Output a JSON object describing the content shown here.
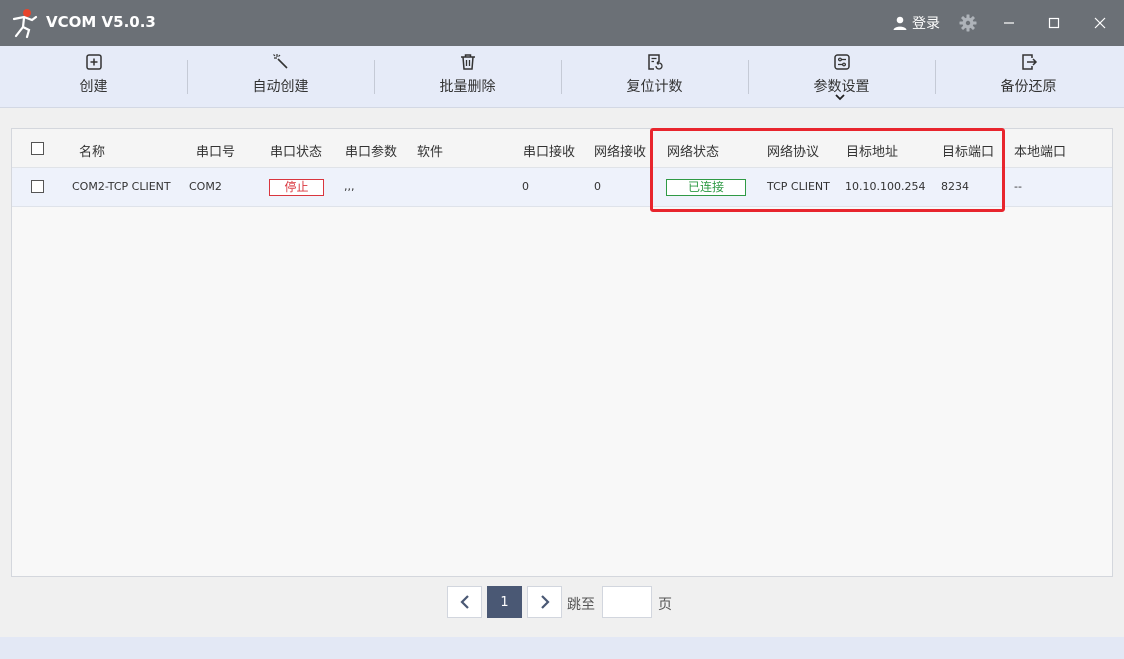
{
  "window": {
    "title": "VCOM V5.0.3",
    "login_label": "登录"
  },
  "toolbar": {
    "items": [
      {
        "label": "创建",
        "icon": "add-icon"
      },
      {
        "label": "自动创建",
        "icon": "magic-wand-icon"
      },
      {
        "label": "批量删除",
        "icon": "trash-icon"
      },
      {
        "label": "复位计数",
        "icon": "reset-icon"
      },
      {
        "label": "参数设置",
        "icon": "settings-sliders-icon"
      },
      {
        "label": "备份还原",
        "icon": "backup-restore-icon"
      }
    ]
  },
  "table": {
    "headers": [
      "名称",
      "串口号",
      "串口状态",
      "串口参数",
      "软件",
      "串口接收",
      "网络接收",
      "网络状态",
      "网络协议",
      "目标地址",
      "目标端口",
      "本地端口"
    ],
    "rows": [
      {
        "name": "COM2-TCP CLIENT",
        "port": "COM2",
        "serial_status": "停止",
        "serial_params": ",,,",
        "software": "",
        "serial_rx": "0",
        "net_rx": "0",
        "net_status": "已连接",
        "protocol": "TCP CLIENT",
        "target_addr": "10.10.100.254",
        "target_port": "8234",
        "local_port": "--"
      }
    ]
  },
  "pagination": {
    "current_page": "1",
    "goto_label": "跳至",
    "page_suffix": "页",
    "goto_value": ""
  },
  "colors": {
    "titlebar": "#6b7076",
    "toolbar": "#e6ebf8",
    "stop": "#d9363e",
    "connected": "#2f9a45",
    "highlight": "#e8252d",
    "page_active": "#4a5874"
  }
}
